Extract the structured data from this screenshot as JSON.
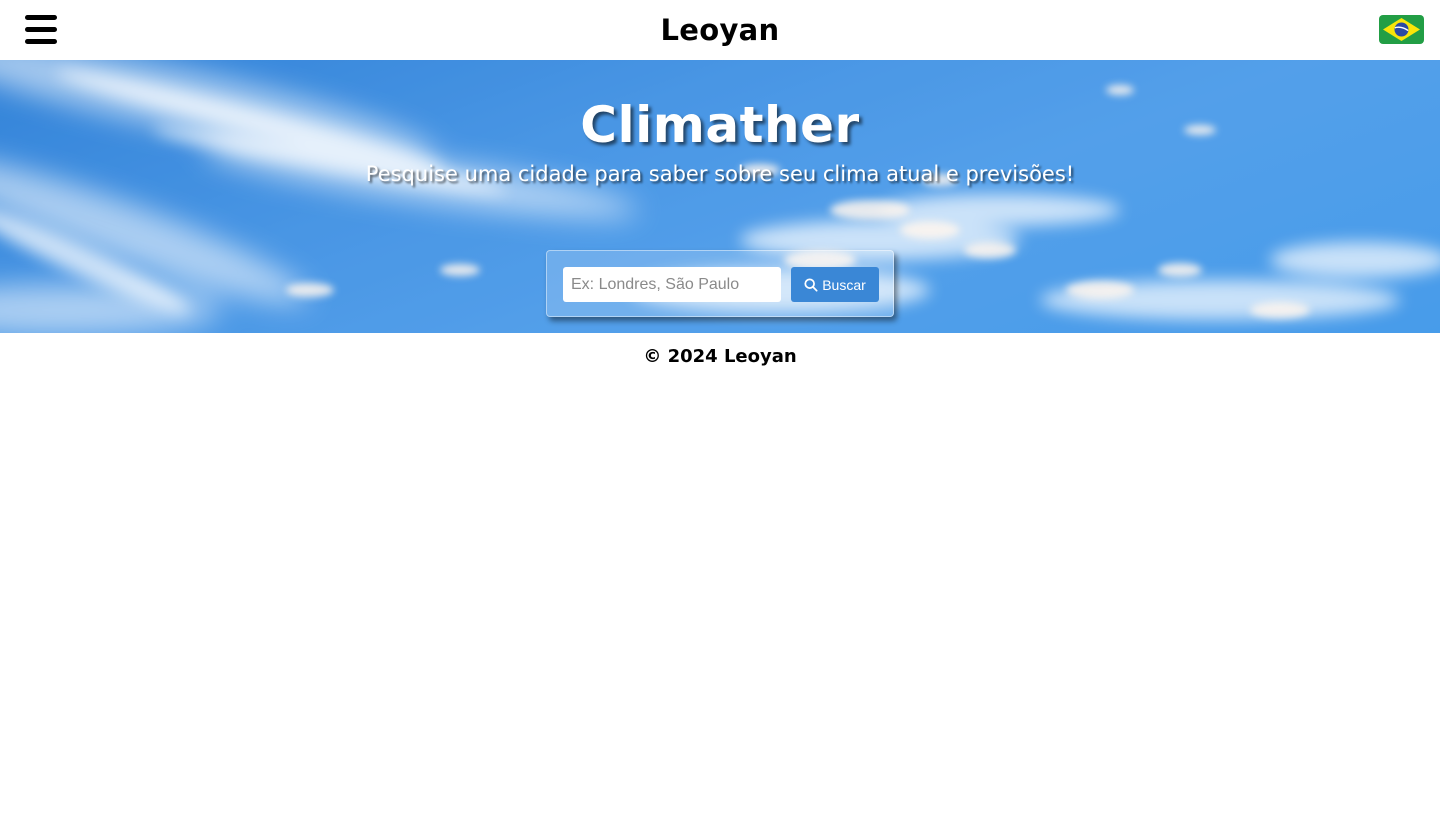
{
  "header": {
    "menu_icon": "hamburger-menu-icon",
    "brand": "Leoyan",
    "language_flag": "brazil-flag-icon"
  },
  "hero": {
    "title": "Climather",
    "subtitle": "Pesquise uma cidade para saber sobre seu clima atual e previsões!",
    "background": "blue-sky-clouds-photo"
  },
  "search": {
    "placeholder": "Ex: Londres, São Paulo",
    "value": "",
    "button_label": "Buscar",
    "button_icon": "search-icon"
  },
  "footer": {
    "copyright": "© 2024 Leoyan"
  },
  "colors": {
    "accent": "#3a87d6",
    "sky": "#4c98e6",
    "flag_green": "#229e45",
    "flag_yellow": "#f8e509",
    "flag_blue": "#2b49a3"
  }
}
